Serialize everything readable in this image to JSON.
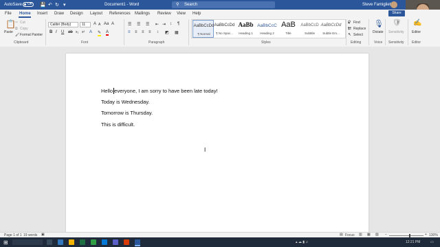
{
  "titlebar": {
    "autosave_label": "AutoSave",
    "autosave_state": "Off",
    "document_title": "Document1  -  Word",
    "search_placeholder": "Search",
    "user_name": "Steve Famiglietti"
  },
  "tabs": [
    "File",
    "Home",
    "Insert",
    "Draw",
    "Design",
    "Layout",
    "References",
    "Mailings",
    "Review",
    "View",
    "Help"
  ],
  "active_tab": "Home",
  "share_label": "Share",
  "ribbon": {
    "clipboard": {
      "paste": "Paste",
      "cut": "Cut",
      "copy": "Copy",
      "format_painter": "Format Painter",
      "group": "Clipboard"
    },
    "font": {
      "name": "Calibri (Body)",
      "size": "11",
      "group": "Font"
    },
    "paragraph": {
      "group": "Paragraph"
    },
    "styles": {
      "group": "Styles",
      "items": [
        {
          "preview": "AaBbCcDd",
          "name": "¶ Normal"
        },
        {
          "preview": "AaBbCcDd",
          "name": "¶ No Spac..."
        },
        {
          "preview": "AaBb",
          "name": "Heading 1"
        },
        {
          "preview": "AaBbCcC",
          "name": "Heading 2"
        },
        {
          "preview": "AaB",
          "name": "Title"
        },
        {
          "preview": "AaBbCcD",
          "name": "Subtitle"
        },
        {
          "preview": "AaBbCcDd",
          "name": "Subtle Em..."
        }
      ]
    },
    "editing": {
      "find": "Find",
      "replace": "Replace",
      "select": "Select",
      "group": "Editing"
    },
    "voice": {
      "dictate": "Dictate",
      "group": "Voice"
    },
    "sensitivity": {
      "label": "Sensitivity",
      "group": "Sensitivity"
    },
    "editor": {
      "label": "Editor",
      "group": "Editor"
    }
  },
  "document": {
    "paragraphs": [
      "Hello everyone, I am sorry to have been late today!",
      "Today is Wednesday.",
      "Tomorrow is Thursday.",
      "This is difficult."
    ]
  },
  "statusbar": {
    "page": "Page 1 of 1",
    "words": "19 words",
    "focus": "Focus",
    "zoom": "130%"
  },
  "taskbar": {
    "time": "12:21 PM"
  },
  "colors": {
    "accent": "#2b579a",
    "taskbar": "#1f2b3a"
  }
}
